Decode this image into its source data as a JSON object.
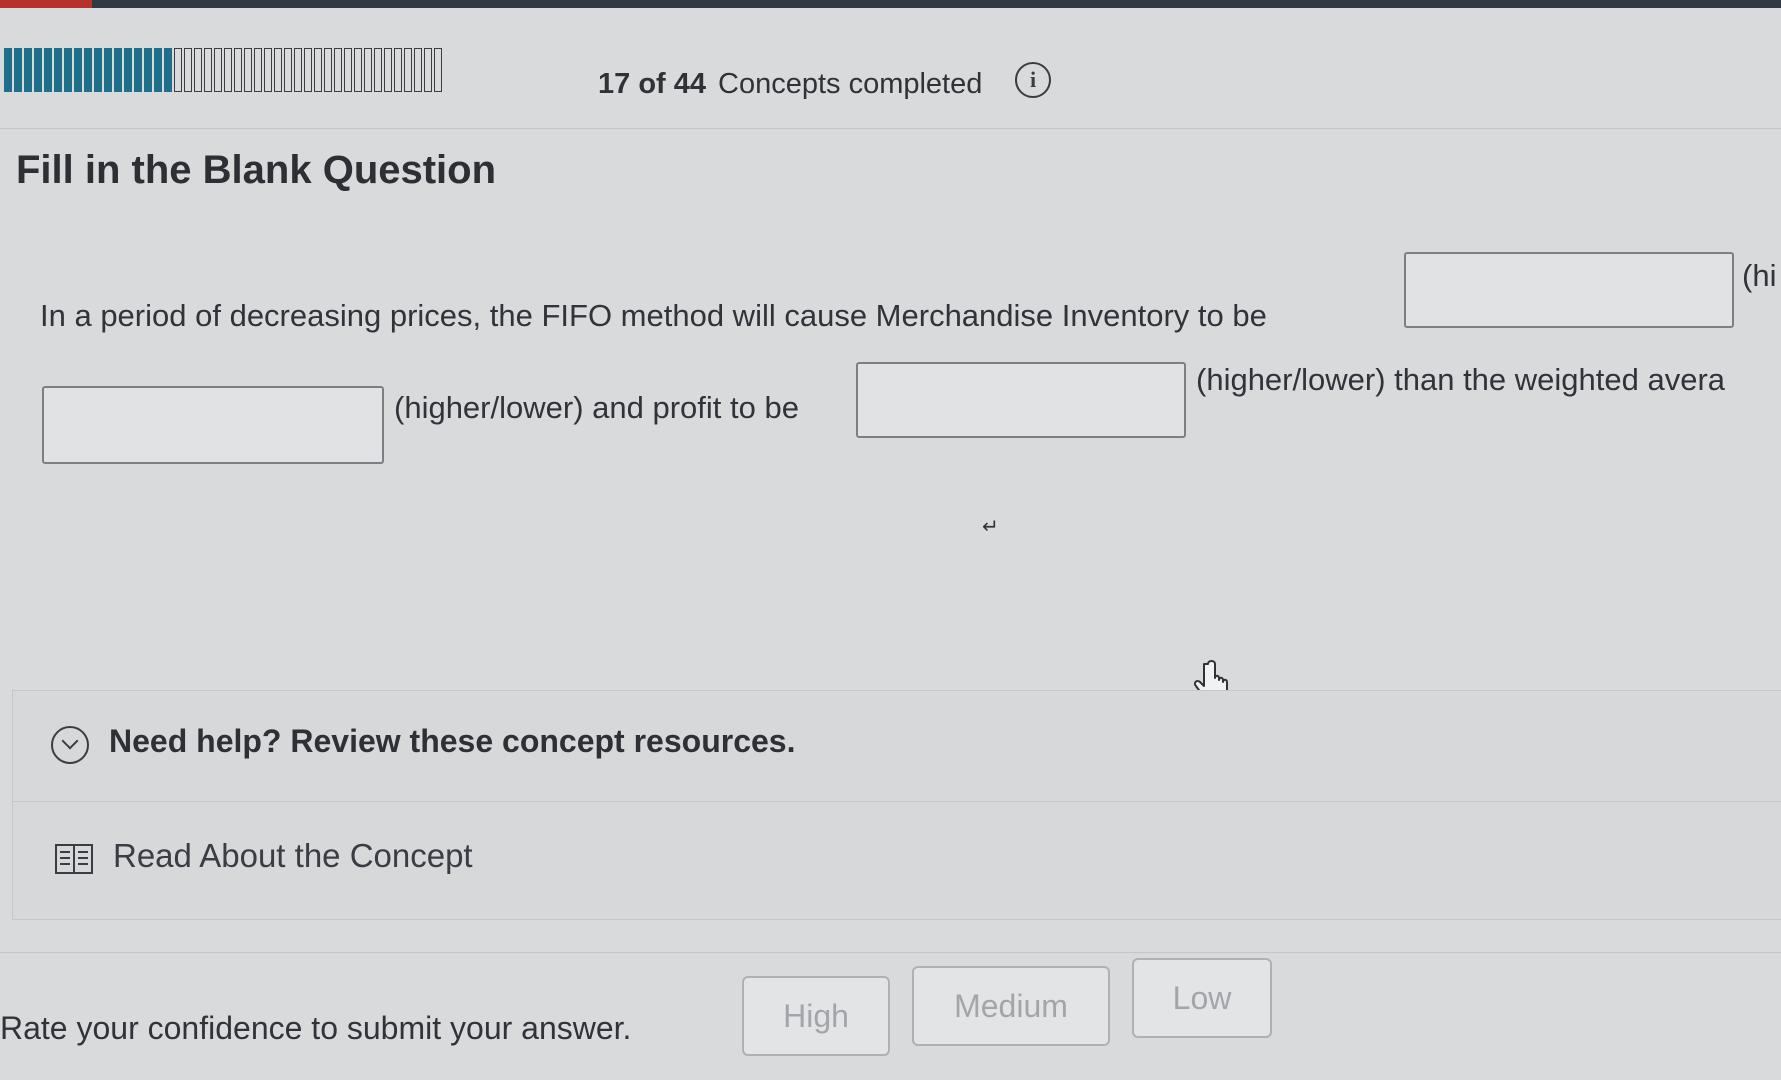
{
  "progress": {
    "completed": 17,
    "total": 44,
    "count_text": "17 of 44",
    "label": "Concepts completed",
    "info_icon": "info-icon",
    "bar_color": "#1d6f8a"
  },
  "question": {
    "title": "Fill in the Blank Question",
    "line1": "In a period of decreasing prices, the FIFO method will cause Merchandise Inventory to be",
    "line1_tail": "(hi",
    "line2_mid": "(higher/lower) and profit to be",
    "line2_tail": "(higher/lower) than the weighted avera",
    "blanks": [
      "",
      "",
      ""
    ]
  },
  "help": {
    "heading": "Need help? Review these concept resources.",
    "expand_icon": "chevron-down-icon",
    "read_label": "Read About the Concept",
    "read_icon": "book-icon"
  },
  "confidence": {
    "prompt": "Rate your confidence to submit your answer.",
    "buttons": [
      "High",
      "Medium",
      "Low"
    ]
  }
}
